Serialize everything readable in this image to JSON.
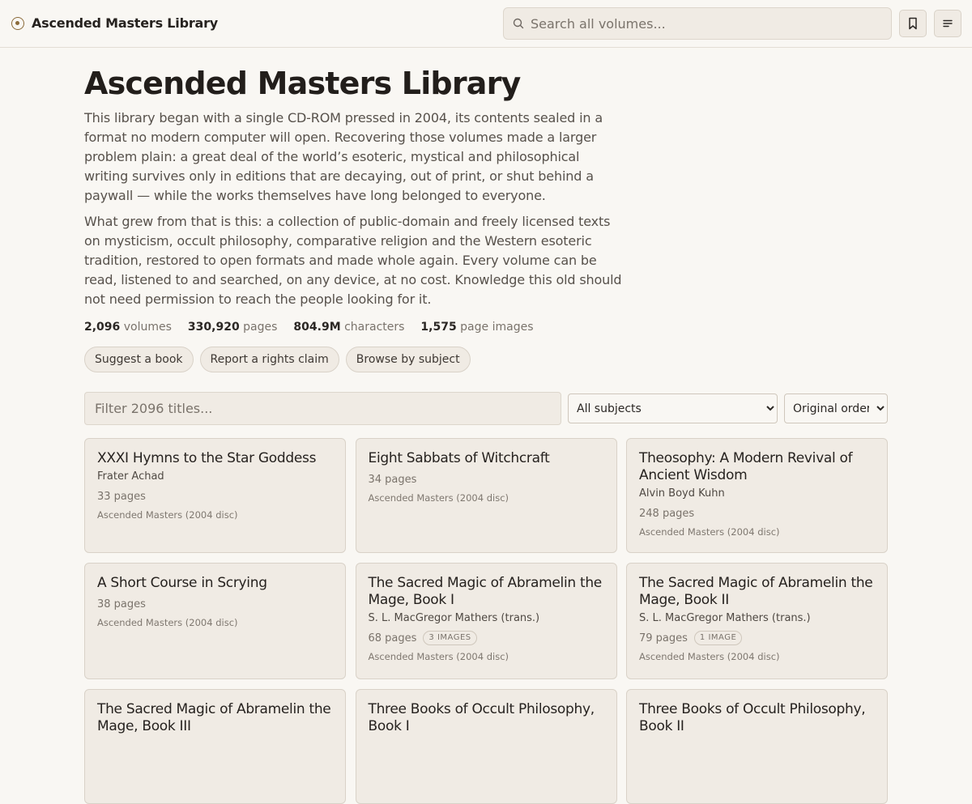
{
  "header": {
    "brand": "Ascended Masters Library",
    "search_placeholder": "Search all volumes..."
  },
  "icons": {
    "brand": "circle-dot-icon",
    "search": "search-icon",
    "bookmark": "bookmark-icon",
    "menu": "menu-icon"
  },
  "page": {
    "title": "Ascended Masters Library",
    "intro1": "This library began with a single CD-ROM pressed in 2004, its contents sealed in a format no modern computer will open. Recovering those volumes made a larger problem plain: a great deal of the world’s esoteric, mystical and philosophical writing survives only in editions that are decaying, out of print, or shut behind a paywall — while the works themselves have long belonged to everyone.",
    "intro2": "What grew from that is this: a collection of public-domain and freely licensed texts on mysticism, occult philosophy, comparative religion and the Western esoteric tradition, restored to open formats and made whole again. Every volume can be read, listened to and searched, on any device, at no cost. Knowledge this old should not need permission to reach the people looking for it."
  },
  "stats": [
    {
      "value": "2,096",
      "label": "volumes"
    },
    {
      "value": "330,920",
      "label": "pages"
    },
    {
      "value": "804.9M",
      "label": "characters"
    },
    {
      "value": "1,575",
      "label": "page images"
    }
  ],
  "actions": {
    "suggest": "Suggest a book",
    "report": "Report a rights claim",
    "browse": "Browse by subject"
  },
  "filters": {
    "title_placeholder": "Filter 2096 titles...",
    "subject_selected": "All subjects",
    "order_selected": "Original order"
  },
  "books": [
    {
      "title": "XXXI Hymns to the Star Goddess",
      "author": "Frater Achad",
      "pages": "33 pages",
      "badge": "",
      "source": "Ascended Masters (2004 disc)"
    },
    {
      "title": "Eight Sabbats of Witchcraft",
      "author": "",
      "pages": "34 pages",
      "badge": "",
      "source": "Ascended Masters (2004 disc)"
    },
    {
      "title": "Theosophy: A Modern Revival of Ancient Wisdom",
      "author": "Alvin Boyd Kuhn",
      "pages": "248 pages",
      "badge": "",
      "source": "Ascended Masters (2004 disc)"
    },
    {
      "title": "A Short Course in Scrying",
      "author": "",
      "pages": "38 pages",
      "badge": "",
      "source": "Ascended Masters (2004 disc)"
    },
    {
      "title": "The Sacred Magic of Abramelin the Mage, Book I",
      "author": "S. L. MacGregor Mathers (trans.)",
      "pages": "68 pages",
      "badge": "3 IMAGES",
      "source": "Ascended Masters (2004 disc)"
    },
    {
      "title": "The Sacred Magic of Abramelin the Mage, Book II",
      "author": "S. L. MacGregor Mathers (trans.)",
      "pages": "79 pages",
      "badge": "1 IMAGE",
      "source": "Ascended Masters (2004 disc)"
    },
    {
      "title": "The Sacred Magic of Abramelin the Mage, Book III",
      "author": "",
      "pages": "",
      "badge": "",
      "source": ""
    },
    {
      "title": "Three Books of Occult Philosophy, Book I",
      "author": "",
      "pages": "",
      "badge": "",
      "source": ""
    },
    {
      "title": "Three Books of Occult Philosophy, Book II",
      "author": "",
      "pages": "",
      "badge": "",
      "source": ""
    }
  ]
}
